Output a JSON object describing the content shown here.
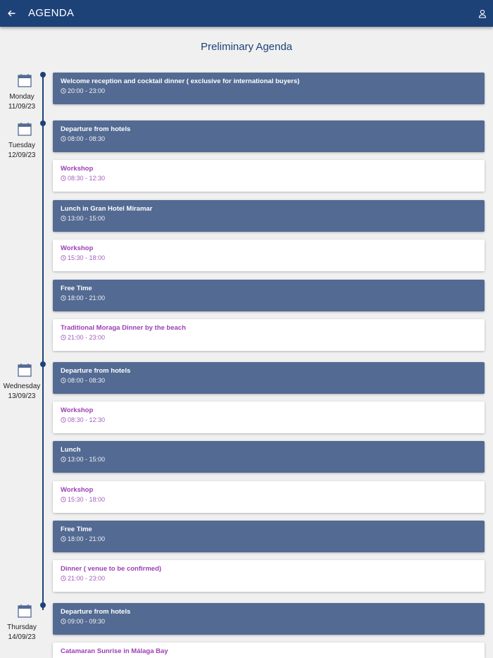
{
  "header": {
    "title": "AGENDA"
  },
  "page": {
    "title": "Preliminary Agenda"
  },
  "colors": {
    "header": "#1c4278",
    "dark_card": "#536a93",
    "light_card": "#ffffff",
    "accent_text": "#9b3fb5"
  },
  "days": [
    {
      "name": "Monday",
      "date": "11/09/23"
    },
    {
      "name": "Tuesday",
      "date": "12/09/23"
    },
    {
      "name": "Wednesday",
      "date": "13/09/23"
    },
    {
      "name": "Thursday",
      "date": "14/09/23"
    }
  ],
  "events": [
    {
      "title": "Welcome reception and cocktail dinner ( exclusive for international buyers)",
      "time": "20:00 - 23:00",
      "style": "dark"
    },
    {
      "title": "Departure from hotels",
      "time": "08:00 - 08:30",
      "style": "dark"
    },
    {
      "title": "Workshop",
      "time": "08:30 - 12:30",
      "style": "light"
    },
    {
      "title": "Lunch in Gran Hotel Miramar",
      "time": "13:00 - 15:00",
      "style": "dark"
    },
    {
      "title": "Workshop",
      "time": "15:30 - 18:00",
      "style": "light"
    },
    {
      "title": "Free Time",
      "time": "18:00 - 21:00",
      "style": "dark"
    },
    {
      "title": "Traditional Moraga Dinner by the beach",
      "time": "21:00 - 23:00",
      "style": "light"
    },
    {
      "title": "Departure from hotels",
      "time": "08:00 - 08:30",
      "style": "dark"
    },
    {
      "title": "Workshop",
      "time": "08:30 - 12:30",
      "style": "light"
    },
    {
      "title": "Lunch",
      "time": "13:00 - 15:00",
      "style": "dark"
    },
    {
      "title": "Workshop",
      "time": "15:30 - 18:00",
      "style": "light"
    },
    {
      "title": "Free Time",
      "time": "18:00 - 21:00",
      "style": "dark"
    },
    {
      "title": "Dinner ( venue to be confirmed)",
      "time": "21:00 - 23:00",
      "style": "light"
    },
    {
      "title": "Departure from hotels",
      "time": "09:00 - 09:30",
      "style": "dark"
    },
    {
      "title": "Catamaran Sunrise in Málaga Bay",
      "time": "",
      "style": "light"
    }
  ]
}
